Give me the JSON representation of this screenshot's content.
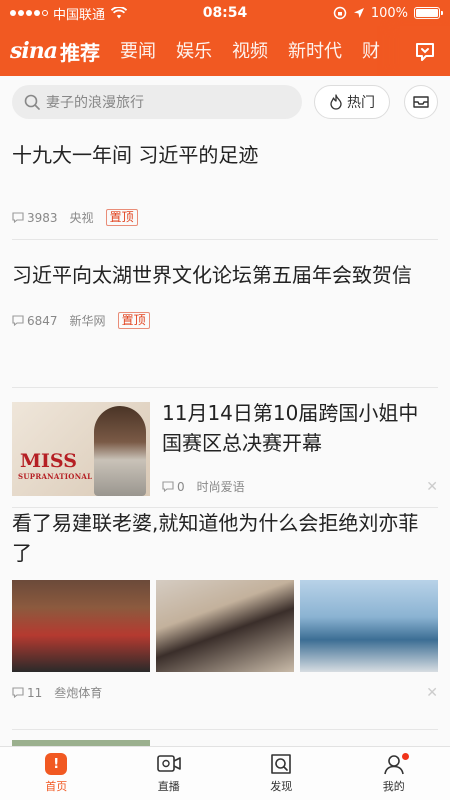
{
  "status_bar": {
    "carrier": "中国联通",
    "time": "08:54",
    "battery": "100%",
    "battery_level": 1.0
  },
  "header": {
    "logo": "sina",
    "tabs": [
      "推荐",
      "要闻",
      "娱乐",
      "视频",
      "新时代",
      "财"
    ],
    "active_tab": "推荐"
  },
  "search": {
    "placeholder": "妻子的浪漫旅行",
    "hot_label": "热门"
  },
  "feed": [
    {
      "title": "十九大一年间 习近平的足迹",
      "comments": "3983",
      "source": "央视",
      "tag": "置顶"
    },
    {
      "title": "习近平向太湖世界文化论坛第五届年会致贺信",
      "comments": "6847",
      "source": "新华网",
      "tag": "置顶"
    },
    {
      "title": "11月14日第10届跨国小姐中国赛区总决赛开幕",
      "comments": "0",
      "source": "时尚爱语",
      "thumb_text": [
        "MISS",
        "SUPRANATIONAL"
      ]
    },
    {
      "title": "看了易建联老婆,就知道他为什么会拒绝刘亦菲了",
      "comments": "11",
      "source": "叁炮体育"
    }
  ],
  "colors": {
    "brand": "#f15922",
    "pin_tag": "#e2421d"
  },
  "tabbar": {
    "items": [
      {
        "label": "首页",
        "icon": "home-icon",
        "active": true
      },
      {
        "label": "直播",
        "icon": "live-icon",
        "active": false
      },
      {
        "label": "发现",
        "icon": "discover-icon",
        "active": false
      },
      {
        "label": "我的",
        "icon": "profile-icon",
        "active": false,
        "badge": true
      }
    ]
  }
}
